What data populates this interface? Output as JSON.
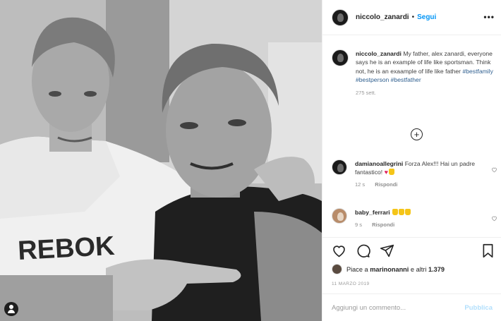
{
  "post": {
    "author": "niccolo_zanardi",
    "follow_label": "Segui",
    "more_label": "•••",
    "caption_author": "niccolo_zanardi",
    "caption_text": "My father, alex zanardi, everyone says he is an example of life like sportsman. Think not, he is an exaample of life like father",
    "hashtags": "#bestfamily #bestperson #bestfather",
    "caption_time": "275 sett.",
    "load_more_label": "+"
  },
  "photo": {
    "shirt_text": "REBOK"
  },
  "comments": [
    {
      "user": "damianoallegrini",
      "text": "Forza Alex!!! Hai un padre fantastico!",
      "time": "12 s",
      "reply_label": "Rispondi",
      "emoji": "heart, hand"
    },
    {
      "user": "baby_ferrari",
      "text": "",
      "time": "9 s",
      "reply_label": "Rispondi",
      "emoji": "hand, hand, hand"
    }
  ],
  "actions": {
    "icons": [
      "heart-icon",
      "comment-icon",
      "share-icon",
      "bookmark-icon"
    ],
    "likes_prefix": "Piace a",
    "likes_user": "marinonanni",
    "likes_suffix": "e altri",
    "likes_count": "1.379",
    "date": "11 MARZO 2019"
  },
  "add_comment": {
    "placeholder": "Aggiungi un commento...",
    "publish_label": "Pubblica"
  },
  "colors": {
    "accent": "#0095f6",
    "publish_disabled": "#b2dffc",
    "hashtag": "#2f5f8f",
    "heart": "#e0245e"
  }
}
